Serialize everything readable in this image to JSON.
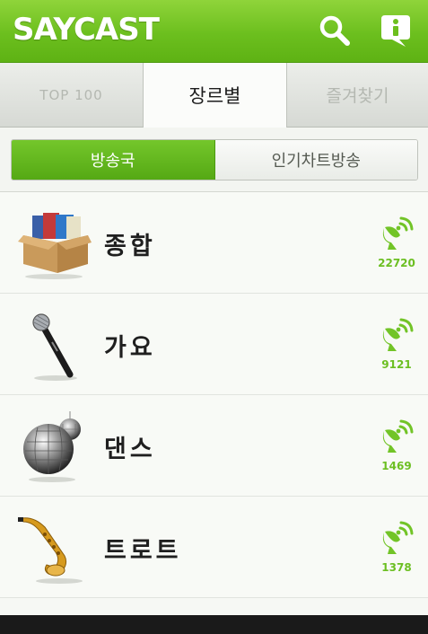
{
  "header": {
    "logo": "SAYCAST",
    "search_icon": "search-icon",
    "info_icon": "info-icon",
    "accent_color": "#6cbf1e"
  },
  "tabs": [
    {
      "label": "TOP 100",
      "selected": false
    },
    {
      "label": "장르별",
      "selected": true
    },
    {
      "label": "즐겨찾기",
      "selected": false
    }
  ],
  "segment": {
    "options": [
      {
        "label": "방송국",
        "selected": true
      },
      {
        "label": "인기차트방송",
        "selected": false
      }
    ]
  },
  "genres": [
    {
      "label": "종합",
      "count": "22720",
      "icon": "cd-box-icon"
    },
    {
      "label": "가요",
      "count": "9121",
      "icon": "microphone-icon"
    },
    {
      "label": "댄스",
      "count": "1469",
      "icon": "disco-ball-icon"
    },
    {
      "label": "트로트",
      "count": "1378",
      "icon": "saxophone-icon"
    }
  ]
}
